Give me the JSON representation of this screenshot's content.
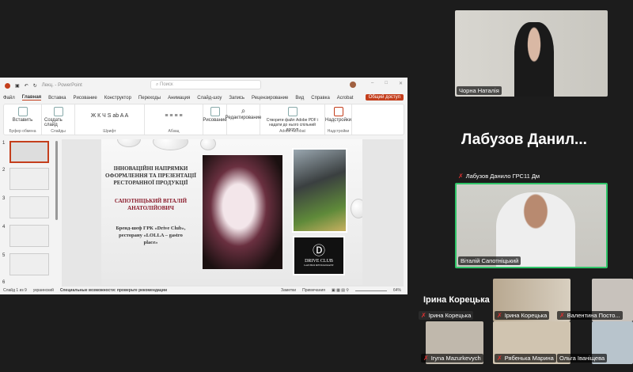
{
  "ppt": {
    "title": "Лекц. - PowerPoint",
    "search_placeholder": "Поиск",
    "menu": [
      "Файл",
      "Главная",
      "Вставка",
      "Рисование",
      "Конструктор",
      "Переходы",
      "Анимация",
      "Слайд-шоу",
      "Запись",
      "Рецензирование",
      "Вид",
      "Справка",
      "Acrobat"
    ],
    "share": "Общий доступ",
    "ribbon": {
      "paste": "Вставить",
      "clipboard": "Буфер обмена",
      "new_slide": "Создать слайд",
      "slides": "Слайды",
      "font": "Шрифт",
      "paragraph": "Абзац",
      "drawing": "Рисование",
      "editing": "Редактирование",
      "adobe_create": "Створити файл Adobe PDF і надати до нього спільний доступ",
      "adobe": "Adobe Acrobat",
      "addins": "Надстройки",
      "addins_group": "Надстройки"
    },
    "thumb_numbers": [
      "1",
      "2",
      "3",
      "4",
      "5",
      "6"
    ],
    "slide": {
      "title": "ІННОВАЦІЙНІ НАПРЯМКИ ОФОРМЛЕННЯ ТА ПРЕЗЕНТАЦІЇ РЕСТОРАННОЇ ПРОДУКЦІЇ",
      "author": "САПОТНІЦЬКИЙ ВІТАЛІЙ АНАТОЛІЙОВИЧ",
      "role": "Бренд-шеф ГРК «Drive Club», ресторану «LOLLA – gastro place»",
      "logo_text": "DRIVE CLUB",
      "logo_sub": "GASTRO RESTAURANT",
      "logo_letter": "D"
    },
    "status": {
      "slide": "Слайд 1 из 9",
      "lang": "украинский",
      "accessibility": "Специальные возможности: проверьте рекомендации",
      "notes": "Заметки",
      "comments": "Примечания",
      "zoom": "64%"
    }
  },
  "participants": {
    "top": "Чорна Наталія",
    "big_name": "Лабузов  Данил...",
    "labuzov_label": "Лабузов Данило ГРС11 Дм",
    "speaker": "Віталій Сапотніцький",
    "irina_big": "Ірина Корецька",
    "irina_label": "Ірина Корецька",
    "grid": [
      "Ірина Корецька",
      "Валентина Посто...",
      "Iryna Mazurkevych",
      "Рябенька Марина",
      "Ольга Іваніщева"
    ]
  }
}
